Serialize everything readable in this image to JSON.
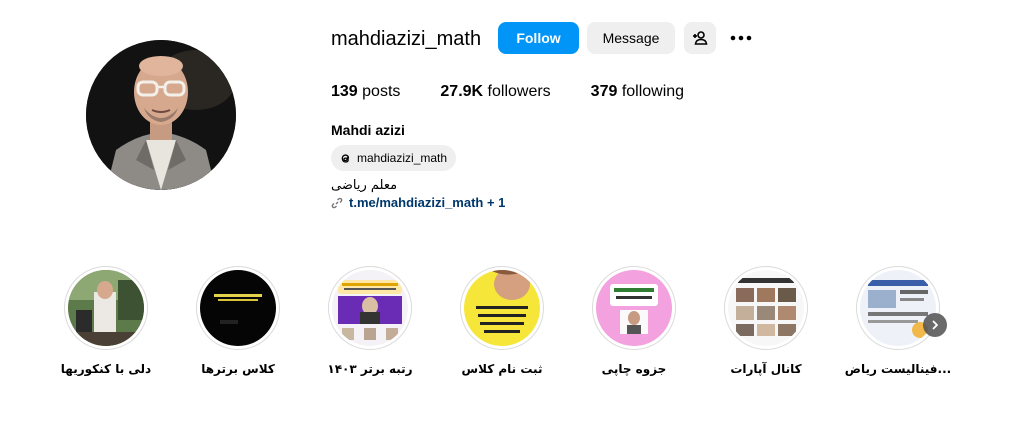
{
  "profile": {
    "username": "mahdiazizi_math",
    "full_name": "Mahdi azizi",
    "bio": "معلم ریاضی",
    "threads_handle": "mahdiazizi_math",
    "link_text": "t.me/mahdiazizi_math + 1"
  },
  "actions": {
    "follow_label": "Follow",
    "message_label": "Message"
  },
  "stats": {
    "posts_value": "139",
    "posts_label": " posts",
    "followers_value": "27.9K",
    "followers_label": " followers",
    "following_value": "379",
    "following_label": " following"
  },
  "highlights": [
    {
      "label": "دلی با کنکوریها"
    },
    {
      "label": "کلاس برترها"
    },
    {
      "label": "رتبه برتر ۱۴۰۳"
    },
    {
      "label": "ثبت نام کلاس"
    },
    {
      "label": "جزوه چاپی"
    },
    {
      "label": "کانال آپارات"
    },
    {
      "label": "فینالیست ریاض..."
    }
  ],
  "colors": {
    "follow_button": "#0095f6",
    "secondary_button": "#efefef",
    "link": "#00376b"
  }
}
